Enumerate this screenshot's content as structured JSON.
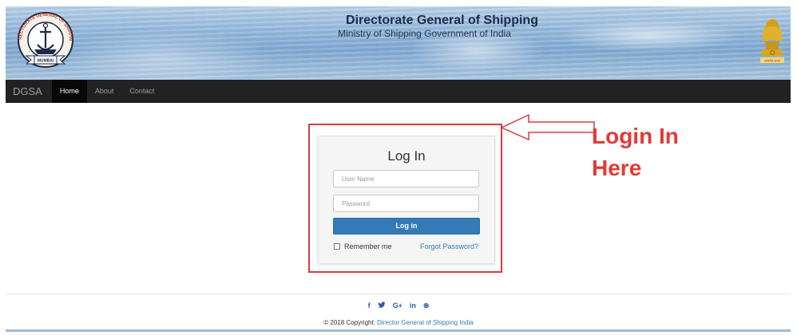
{
  "header": {
    "title": "Directorate General of Shipping",
    "subtitle": "Ministry of Shipping Government of India",
    "logo_left": {
      "icon": "dgs-seal-icon",
      "ring_text": "DIRECTORATE GENERAL OF SHIPPING",
      "ribbon_text": "MUMBAI"
    },
    "logo_right": {
      "icon": "national-emblem-icon",
      "ribbon_text": "सत्यमेव जयते"
    }
  },
  "navbar": {
    "brand": "DGSA",
    "items": [
      {
        "label": "Home",
        "active": true
      },
      {
        "label": "About",
        "active": false
      },
      {
        "label": "Contact",
        "active": false
      }
    ]
  },
  "login": {
    "title": "Log In",
    "username_placeholder": "User Name",
    "password_placeholder": "Password",
    "submit_label": "Log in",
    "remember_label": "Remember me",
    "forgot_label": "Forgot Password?"
  },
  "annotation": {
    "line1": "Login In",
    "line2": "Here",
    "color": "#e53935"
  },
  "footer": {
    "social_icons": [
      {
        "icon": "facebook-icon",
        "glyph": "f"
      },
      {
        "icon": "twitter-icon",
        "glyph": "🐦"
      },
      {
        "icon": "google-plus-icon",
        "glyph": "G+"
      },
      {
        "icon": "linkedin-icon",
        "glyph": "in"
      },
      {
        "icon": "dribbble-icon",
        "glyph": "⊛"
      }
    ],
    "copyright_prefix": "© 2018 Copyright: ",
    "copyright_link": "Director General of Shipping India"
  },
  "colors": {
    "navbar_bg": "#222222",
    "primary": "#337ab7",
    "highlight_border": "#d63b42"
  }
}
